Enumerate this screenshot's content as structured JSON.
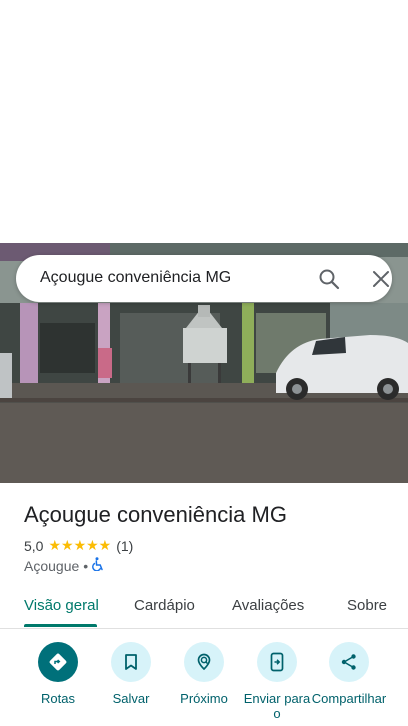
{
  "search": {
    "query": "Açougue conveniência MG"
  },
  "place": {
    "name": "Açougue conveniência MG",
    "rating": "5,0",
    "stars": "★★★★★",
    "review_count": "(1)",
    "category": "Açougue",
    "separator": "•"
  },
  "tabs": [
    {
      "label": "Visão geral"
    },
    {
      "label": "Cardápio"
    },
    {
      "label": "Avaliações"
    },
    {
      "label": "Sobre"
    }
  ],
  "actions": [
    {
      "label": "Rotas",
      "icon": "directions-icon"
    },
    {
      "label": "Salvar",
      "icon": "bookmark-icon"
    },
    {
      "label": "Próximo",
      "icon": "nearby-icon"
    },
    {
      "label": "Enviar para o",
      "icon": "send-to-phone-icon"
    },
    {
      "label": "Compartilhar",
      "icon": "share-icon"
    }
  ],
  "colors": {
    "accent": "#00796b",
    "action_bg": "#d7f3f9",
    "primary_action": "#00707a",
    "stars": "#fbbc04"
  }
}
